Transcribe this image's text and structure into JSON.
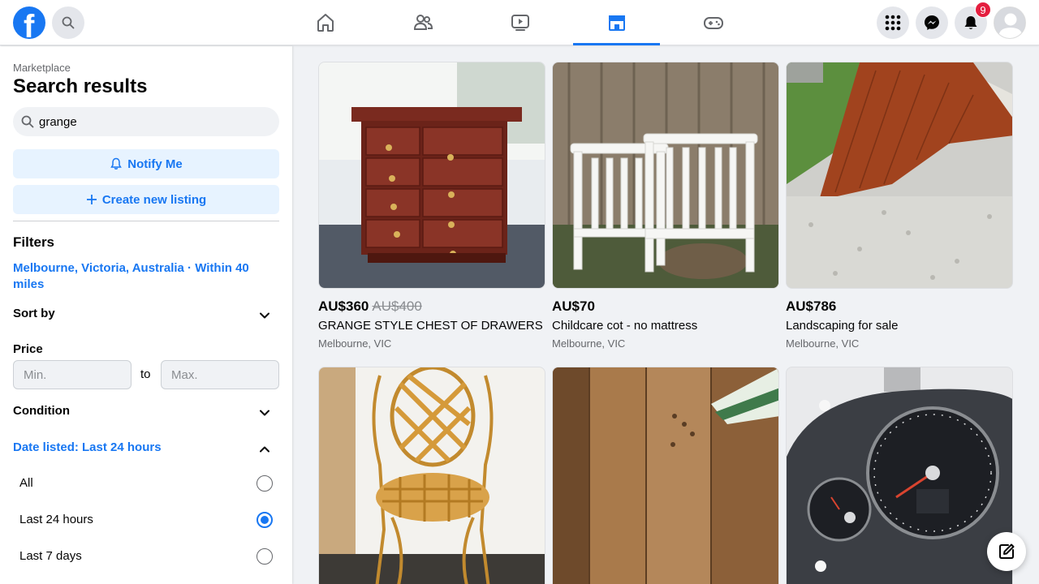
{
  "topbar": {
    "logo_letter": "f",
    "notifications_count": "9",
    "nav_tabs": [
      {
        "name": "home-icon"
      },
      {
        "name": "friends-icon"
      },
      {
        "name": "watch-icon"
      },
      {
        "name": "marketplace-icon",
        "active": true
      },
      {
        "name": "gaming-icon"
      }
    ]
  },
  "sidebar": {
    "breadcrumb": "Marketplace",
    "title": "Search results",
    "search_value": "grange",
    "notify_label": "Notify Me",
    "create_label": "Create new listing",
    "filters_heading": "Filters",
    "location": "Melbourne, Victoria, Australia · Within 40 miles",
    "sort_by_label": "Sort by",
    "price_label": "Price",
    "price_min_placeholder": "Min.",
    "price_max_placeholder": "Max.",
    "price_to": "to",
    "condition_label": "Condition",
    "date_listed_label": "Date listed: Last 24 hours",
    "date_options": [
      {
        "label": "All",
        "selected": false
      },
      {
        "label": "Last 24 hours",
        "selected": true
      },
      {
        "label": "Last 7 days",
        "selected": false
      }
    ]
  },
  "listings": [
    {
      "price": "AU$360",
      "old_price": "AU$400",
      "title": "GRANGE STYLE CHEST OF DRAWERS",
      "location": "Melbourne, VIC"
    },
    {
      "price": "AU$70",
      "title": "Childcare cot - no mattress",
      "location": "Melbourne, VIC"
    },
    {
      "price": "AU$786",
      "title": "Landscaping for sale",
      "location": "Melbourne, VIC"
    },
    {
      "price": "",
      "title": "",
      "location": ""
    },
    {
      "price": "",
      "title": "",
      "location": ""
    },
    {
      "price": "",
      "title": "",
      "location": ""
    }
  ],
  "colors": {
    "accent": "#1877f2",
    "badge": "#e41e3f"
  }
}
